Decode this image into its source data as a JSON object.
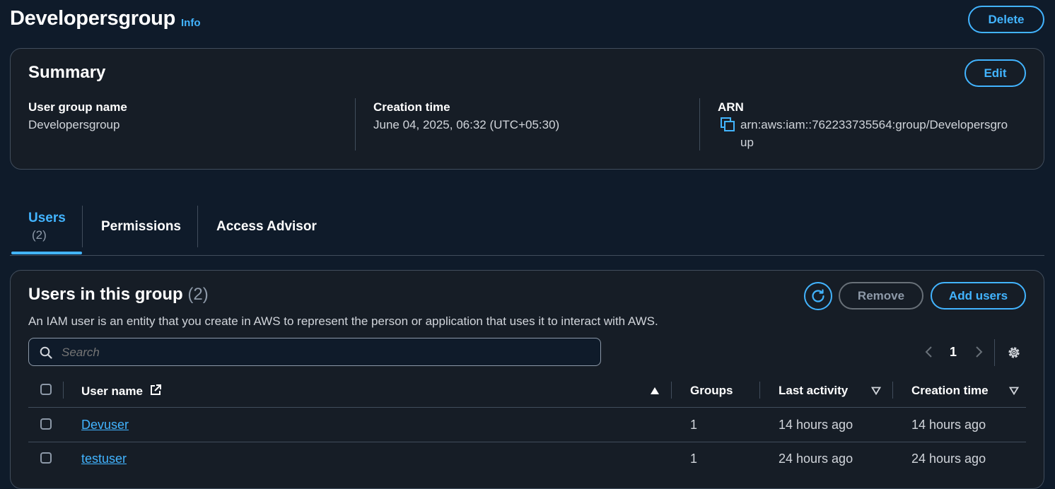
{
  "header": {
    "title": "Developersgroup",
    "info": "Info",
    "delete_label": "Delete"
  },
  "summary": {
    "title": "Summary",
    "edit_label": "Edit",
    "group_name_label": "User group name",
    "group_name_value": "Developersgroup",
    "creation_label": "Creation time",
    "creation_value": "June 04, 2025, 06:32 (UTC+05:30)",
    "arn_label": "ARN",
    "arn_value_line1": "arn:aws:iam::762233735564:group/Developersgro",
    "arn_value_line2": "up"
  },
  "tabs": [
    {
      "label": "Users",
      "count": "(2)"
    },
    {
      "label": "Permissions"
    },
    {
      "label": "Access Advisor"
    }
  ],
  "users_panel": {
    "title": "Users in this group",
    "count": "(2)",
    "description": "An IAM user is an entity that you create in AWS to represent the person or application that uses it to interact with AWS.",
    "remove_label": "Remove",
    "add_label": "Add users",
    "search_placeholder": "Search",
    "page_number": "1",
    "columns": {
      "user_name": "User name",
      "groups": "Groups",
      "last_activity": "Last activity",
      "creation_time": "Creation time"
    },
    "rows": [
      {
        "user_name": "Devuser",
        "groups": "1",
        "last_activity": "14 hours ago",
        "creation_time": "14 hours ago"
      },
      {
        "user_name": "testuser",
        "groups": "1",
        "last_activity": "24 hours ago",
        "creation_time": "24 hours ago"
      }
    ]
  },
  "colors": {
    "background": "#0f1b2a",
    "panel": "#161d26",
    "accent": "#42b4ff",
    "border": "#414d5c"
  }
}
